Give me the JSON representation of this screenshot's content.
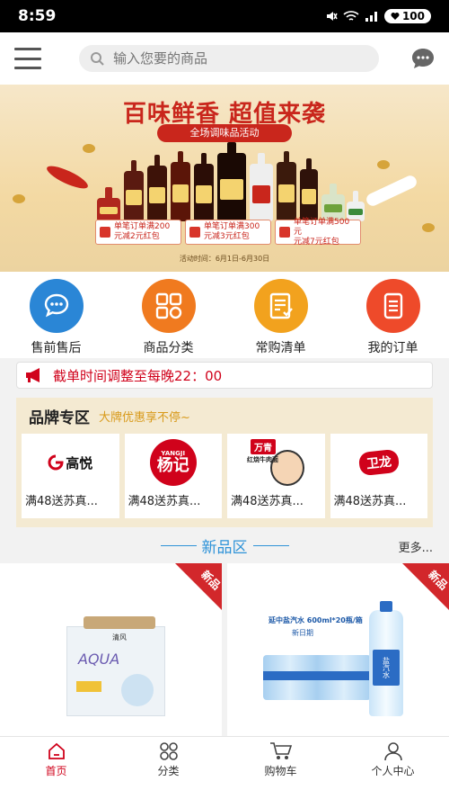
{
  "status": {
    "time": "8:59",
    "battery": "100"
  },
  "search": {
    "placeholder": "输入您要的商品"
  },
  "banner": {
    "title": "百味鲜香 超值来袭",
    "subtitle": "全场调味品活动",
    "coupons": [
      {
        "line1": "单笔订单满200",
        "line2": "元减2元红包"
      },
      {
        "line1": "单笔订单满300",
        "line2": "元减3元红包"
      },
      {
        "line1": "单笔订单满500元",
        "line2": "元减7元红包"
      }
    ],
    "date": "活动时间：6月1日-6月30日",
    "bottle_labels": [
      "调味酱",
      "生抽"
    ]
  },
  "quicknav": [
    {
      "label": "售前售后",
      "icon": "chat-bubble-icon",
      "color": "#2a86d6"
    },
    {
      "label": "商品分类",
      "icon": "category-grid-icon",
      "color": "#f07a1f"
    },
    {
      "label": "常购清单",
      "icon": "checklist-icon",
      "color": "#f2a21e"
    },
    {
      "label": "我的订单",
      "icon": "order-doc-icon",
      "color": "#ee4a2a"
    }
  ],
  "notice": {
    "text": "截单时间调整至每晚22：00"
  },
  "brand": {
    "title": "品牌专区",
    "subtitle": "大牌优惠享不停~",
    "cards": [
      {
        "logo": "高悦",
        "promo": "满48送苏真..."
      },
      {
        "logo": "杨记",
        "logo_top": "YANGJI",
        "promo": "满48送苏真..."
      },
      {
        "logo": "万青",
        "logo_sub": "红烧牛肉面",
        "promo": "满48送苏真..."
      },
      {
        "logo": "卫龙",
        "promo": "满48送苏真..."
      }
    ]
  },
  "new_section": {
    "title": "新品区",
    "more": "更多..."
  },
  "products": [
    {
      "badge": "新品",
      "brand_text": "AQUA",
      "sub_text": "清风"
    },
    {
      "badge": "新品",
      "banner_text": "延中盐汽水 600ml*20瓶/箱",
      "banner_sub": "新日期",
      "bottle_text": "盐汽水"
    }
  ],
  "tabs": [
    {
      "label": "首页",
      "icon": "home-icon",
      "active": true
    },
    {
      "label": "分类",
      "icon": "category-icon",
      "active": false
    },
    {
      "label": "购物车",
      "icon": "cart-icon",
      "active": false
    },
    {
      "label": "个人中心",
      "icon": "user-icon",
      "active": false
    }
  ],
  "colors": {
    "accent": "#d0021b",
    "brand_bg": "#f4ead2",
    "new_blue": "#2f93d8"
  }
}
